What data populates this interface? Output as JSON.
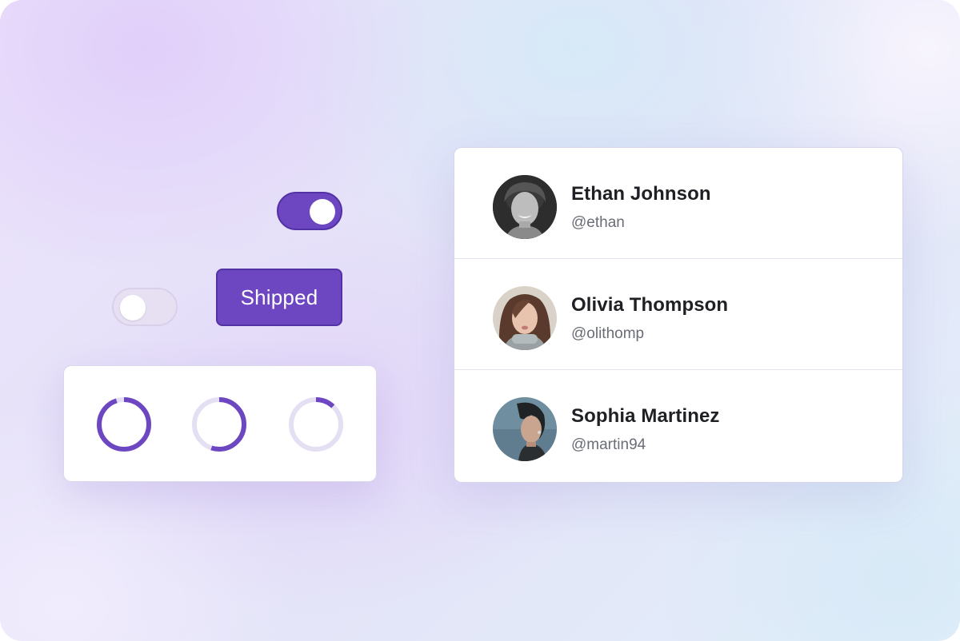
{
  "controls": {
    "toggle_top": {
      "state": "on"
    },
    "toggle_bottom": {
      "state": "off"
    },
    "shipped_button": {
      "label": "Shipped"
    }
  },
  "progress_rings": [
    {
      "progress": 0.95
    },
    {
      "progress": 0.55
    },
    {
      "progress": 0.12
    }
  ],
  "users": [
    {
      "name": "Ethan Johnson",
      "handle": "@ethan",
      "avatar": "avatar-ethan"
    },
    {
      "name": "Olivia Thompson",
      "handle": "@olithomp",
      "avatar": "avatar-olivia"
    },
    {
      "name": "Sophia Martinez",
      "handle": "@martin94",
      "avatar": "avatar-sophia"
    }
  ],
  "colors": {
    "accent": "#6d47c1",
    "accent_border": "#5332a6",
    "track": "#e4dff3",
    "text_primary": "#1f2024",
    "text_secondary": "#6b6d76"
  }
}
